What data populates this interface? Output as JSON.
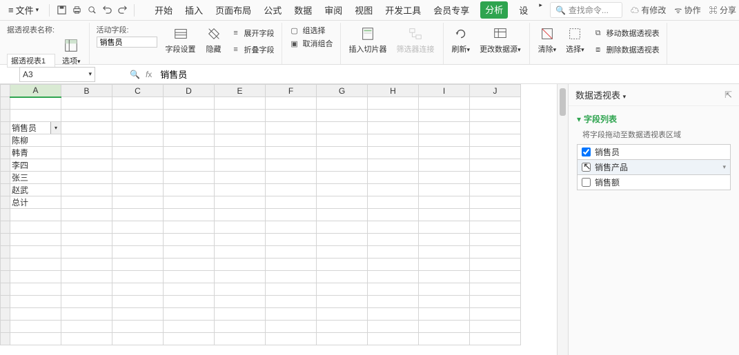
{
  "menubar": {
    "file_label": "文件",
    "tabs": [
      "开始",
      "插入",
      "页面布局",
      "公式",
      "数据",
      "审阅",
      "视图",
      "开发工具",
      "会员专享",
      "分析",
      "设"
    ],
    "search_placeholder": "查找命令...",
    "right": {
      "modified": "有修改",
      "collab": "协作",
      "share": "分享"
    }
  },
  "ribbon": {
    "pivot_name_label": "据透视表名称:",
    "pivot_name_value": "据透视表1",
    "options_label": "选项",
    "active_field_label": "活动字段:",
    "active_field_value": "销售员",
    "field_settings": "字段设置",
    "hide": "隐藏",
    "expand_field": "展开字段",
    "collapse_field": "折叠字段",
    "group_select": "组选择",
    "ungroup": "取消组合",
    "insert_slicer": "插入切片器",
    "filter_conn": "筛选器连接",
    "refresh": "刷新",
    "change_source": "更改数据源",
    "clear": "清除",
    "select": "选择",
    "move_pivot": "移动数据透视表",
    "delete_pivot": "删除数据透视表"
  },
  "formula_bar": {
    "cell_ref": "A3",
    "value": "销售员"
  },
  "columns": [
    "A",
    "B",
    "C",
    "D",
    "E",
    "F",
    "G",
    "H",
    "I",
    "J"
  ],
  "pivot": {
    "header": "销售员",
    "rows": [
      "陈柳",
      "韩青",
      "李四",
      "张三",
      "赵武"
    ],
    "total_label": "总计"
  },
  "side": {
    "title": "数据透视表",
    "field_list_title": "字段列表",
    "field_list_desc": "将字段拖动至数据透视表区域",
    "fields": [
      {
        "name": "销售员",
        "checked": true
      },
      {
        "name": "销售产品",
        "checked": false,
        "highlight": true,
        "has_menu": true
      },
      {
        "name": "销售额",
        "checked": false
      }
    ]
  },
  "chart_data": null
}
